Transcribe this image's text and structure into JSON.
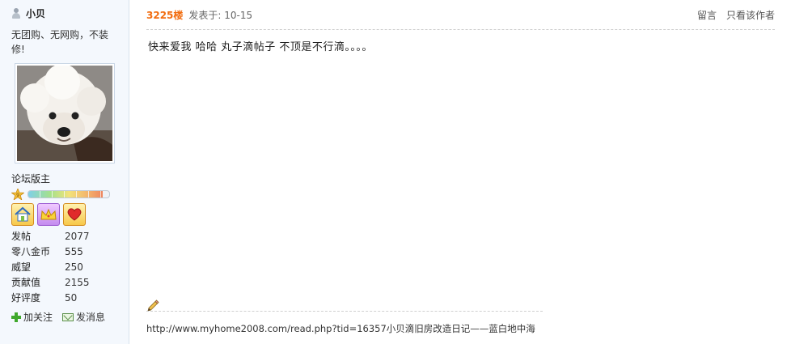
{
  "user": {
    "name": "小贝",
    "signature": "无团购、无网购，不装修!",
    "rank": "论坛版主",
    "level_fraction": 0.92,
    "stats": [
      {
        "label": "发帖",
        "value": "2077"
      },
      {
        "label": "零八金币",
        "value": "555"
      },
      {
        "label": "威望",
        "value": "250"
      },
      {
        "label": "贡献值",
        "value": "2155"
      },
      {
        "label": "好评度",
        "value": "50"
      }
    ],
    "actions": {
      "follow": "加关注",
      "message": "发消息"
    }
  },
  "post": {
    "floor": "3225楼",
    "time": "发表于: 10-15",
    "links": {
      "reply": "留言",
      "author_only": "只看该作者"
    },
    "content": "快来爱我 哈哈 丸子滴帖子 不顶是不行滴。。。。",
    "signature_link": "http://www.myhome2008.com/read.php?tid=16357小贝滴旧房改造日记——蓝白地中海"
  },
  "colors": {
    "floor": "#f26c0e",
    "sidebar_bg": "#f4f8fd"
  }
}
